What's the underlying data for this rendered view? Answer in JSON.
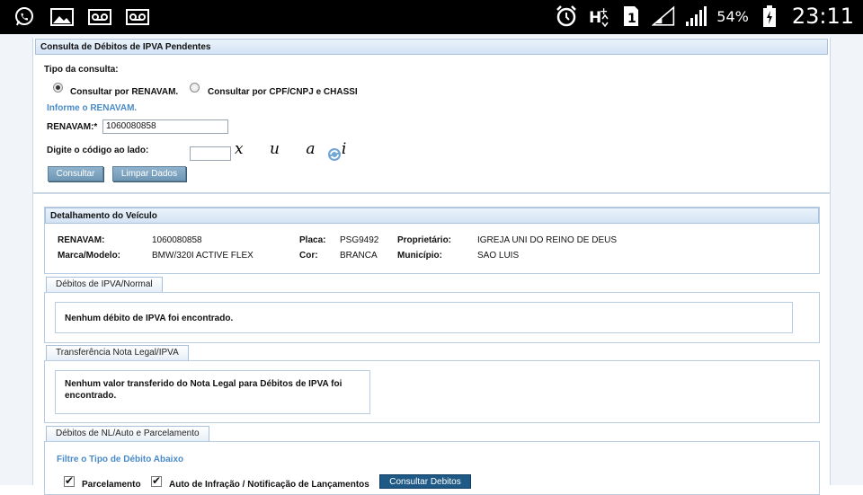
{
  "status_bar": {
    "battery": "54%",
    "time": "23:11",
    "left_icons": [
      "whatsapp-icon",
      "gallery-icon",
      "voicemail-icon",
      "voicemail-icon"
    ],
    "right_icons": [
      "alarm-icon",
      "hplus-icon",
      "sim-1-icon",
      "signal-icon",
      "signal-icon",
      "battery-icon"
    ]
  },
  "consulta": {
    "title": "Consulta de Débitos de IPVA Pendentes",
    "tipo_label": "Tipo da consulta:",
    "option_renavam": "Consultar por RENAVAM.",
    "option_cpf": "Consultar por CPF/CNPJ e CHASSI",
    "selected": "renavam",
    "informe": "Informe o RENAVAM.",
    "renavam_label": "RENAVAM:*",
    "renavam_value": "1060080858",
    "codigo_label": "Digite o código ao lado:",
    "codigo_value": "",
    "captcha_text": "x u a i",
    "btn_consultar": "Consultar",
    "btn_limpar": "Limpar Dados"
  },
  "veiculo": {
    "title": "Detalhamento do Veículo",
    "renavam_label": "RENAVAM:",
    "renavam": "1060080858",
    "placa_label": "Placa:",
    "placa": "PSG9492",
    "proprietario_label": "Proprietário:",
    "proprietario": "IGREJA UNI DO REINO DE DEUS",
    "marca_label": "Marca/Modelo:",
    "marca": "BMW/320I ACTIVE FLEX",
    "cor_label": "Cor:",
    "cor": "BRANCA",
    "municipio_label": "Município:",
    "municipio": "SAO LUIS"
  },
  "ipva_normal": {
    "tab": "Débitos de IPVA/Normal",
    "message": "Nenhum débito de IPVA foi encontrado."
  },
  "nota_legal": {
    "tab": "Transferência Nota Legal/IPVA",
    "message_line1": "Nenhum valor transferido do Nota Legal para Débitos de IPVA foi",
    "message_line2": "encontrado."
  },
  "nl_auto": {
    "tab": "Débitos de NL/Auto e Parcelamento",
    "filter_label": "Filtre o Tipo de Débito Abaixo",
    "check_parcelamento": "Parcelamento",
    "check_auto": "Auto de Infração / Notificação de Lançamentos",
    "btn_consultar_debitos": "Consultar Debitos"
  }
}
